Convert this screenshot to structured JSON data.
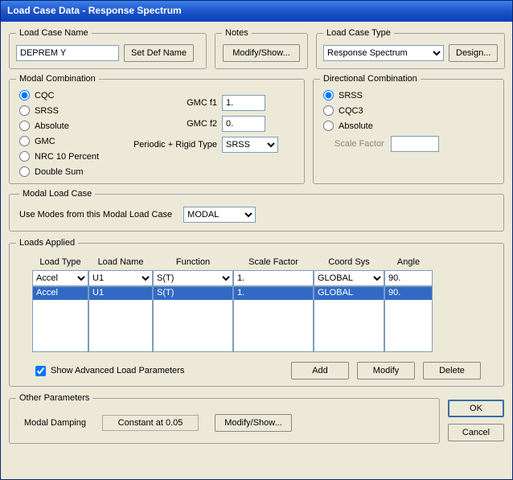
{
  "window": {
    "title": "Load Case Data - Response Spectrum"
  },
  "loadCaseName": {
    "legend": "Load Case Name",
    "value": "DEPREM Y",
    "setDefBtn": "Set Def Name"
  },
  "notes": {
    "legend": "Notes",
    "modifyBtn": "Modify/Show..."
  },
  "loadCaseType": {
    "legend": "Load Case Type",
    "value": "Response Spectrum",
    "designBtn": "Design..."
  },
  "modalComb": {
    "legend": "Modal Combination",
    "options": [
      "CQC",
      "SRSS",
      "Absolute",
      "GMC",
      "NRC 10 Percent",
      "Double Sum"
    ],
    "selected": "CQC",
    "gmcF1": {
      "label": "GMC  f1",
      "value": "1."
    },
    "gmcF2": {
      "label": "GMC  f2",
      "value": "0."
    },
    "periodic": {
      "label": "Periodic + Rigid Type",
      "value": "SRSS"
    }
  },
  "dirComb": {
    "legend": "Directional Combination",
    "options": [
      "SRSS",
      "CQC3",
      "Absolute"
    ],
    "selected": "SRSS",
    "scaleLabel": "Scale Factor"
  },
  "modalLoadCase": {
    "legend": "Modal Load Case",
    "label": "Use Modes from this Modal Load Case",
    "value": "MODAL"
  },
  "loads": {
    "legend": "Loads Applied",
    "headers": [
      "Load Type",
      "Load Name",
      "Function",
      "Scale Factor",
      "Coord Sys",
      "Angle"
    ],
    "inputRow": [
      "Accel",
      "U1",
      "S(T)",
      "1.",
      "GLOBAL",
      "90."
    ],
    "dataRow": [
      "Accel",
      "U1",
      "S(T)",
      "1.",
      "GLOBAL",
      "90."
    ],
    "showAdv": "Show Advanced Load Parameters",
    "addBtn": "Add",
    "modifyBtn": "Modify",
    "deleteBtn": "Delete"
  },
  "otherParams": {
    "legend": "Other Parameters",
    "dampingLabel": "Modal Damping",
    "dampingValue": "Constant at 0.05",
    "modifyBtn": "Modify/Show..."
  },
  "okBtn": "OK",
  "cancelBtn": "Cancel"
}
